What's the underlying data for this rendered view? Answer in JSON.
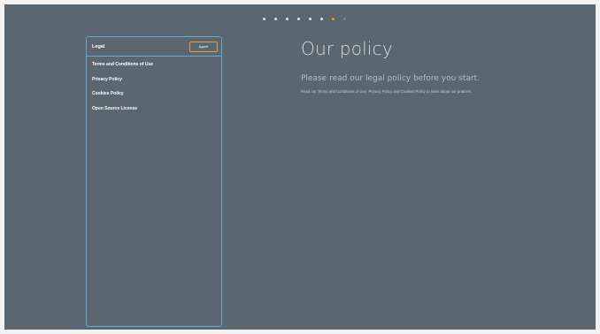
{
  "pager": {
    "dots": [
      "done",
      "done",
      "done",
      "done",
      "done",
      "done",
      "active",
      "upcoming"
    ],
    "colors": {
      "done": "#e8ecef",
      "active": "#f0a020",
      "upcoming": "#7a868f"
    }
  },
  "legal": {
    "title": "Legal",
    "agree_label": "Agree",
    "items": [
      {
        "label": "Terms and Conditions of Use"
      },
      {
        "label": "Privacy Policy"
      },
      {
        "label": "Cookies Policy"
      },
      {
        "label": "Open Source License"
      }
    ]
  },
  "content": {
    "title": "Our policy",
    "subtitle": "Please read our legal policy before you start.",
    "description": "Read our Terms and Conditions of Use, Privacy Policy and Cookies Policy to learn about our pratices."
  },
  "colors": {
    "background": "#5a6670",
    "panel_border": "#69a9c6",
    "accent": "#e0a040"
  }
}
